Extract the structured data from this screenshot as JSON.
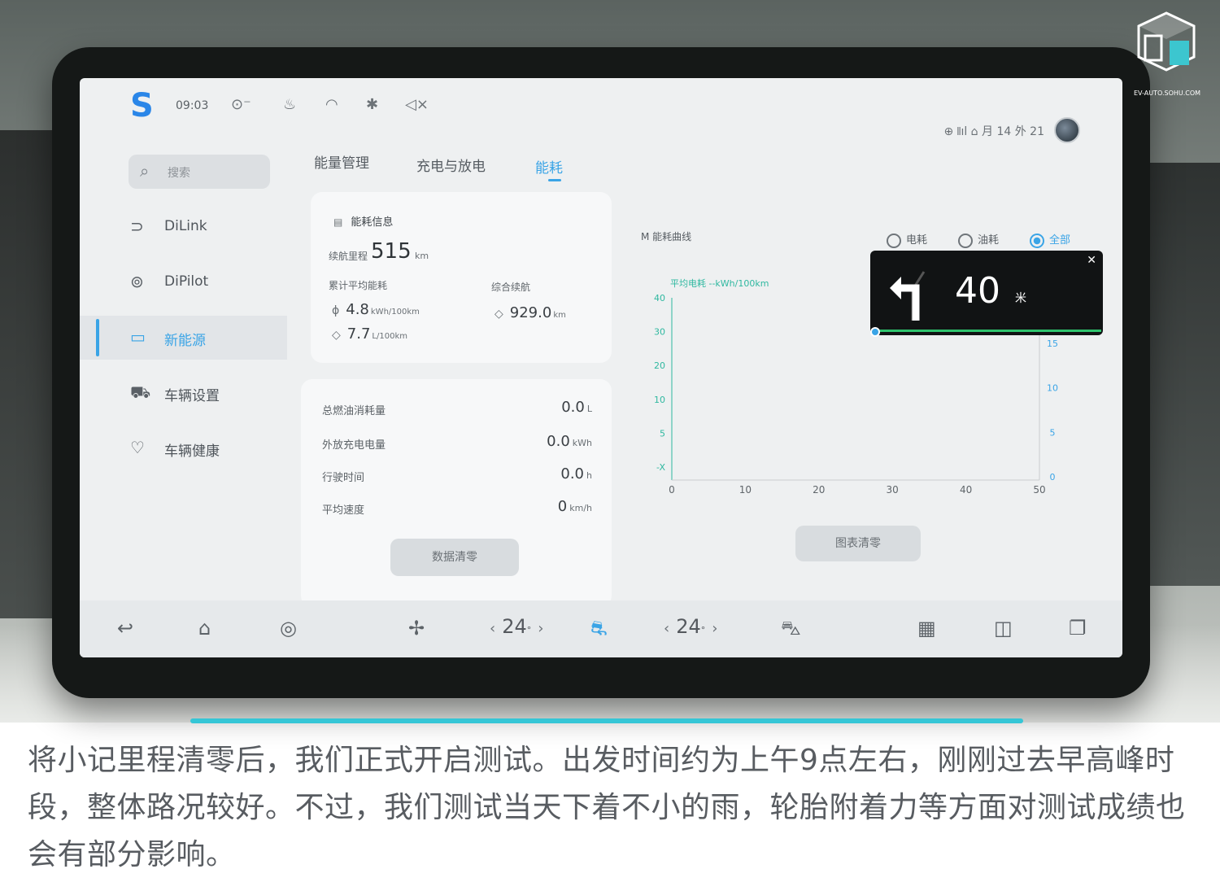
{
  "status_bar": {
    "time": "09:03",
    "icons": [
      "tire-icon",
      "seat-heat-icon",
      "wifi-icon",
      "bluetooth-icon",
      "mute-icon"
    ],
    "right_text": "⊕ 𝍪ıl  ⌂ 月 14 外 21"
  },
  "sidebar": {
    "search_placeholder": "搜索",
    "items": [
      {
        "icon": "dilink-icon",
        "label": "DiLink",
        "active": false
      },
      {
        "icon": "dipilot-icon",
        "label": "DiPilot",
        "active": false
      },
      {
        "icon": "battery-icon",
        "label": "新能源",
        "active": true
      },
      {
        "icon": "car-icon",
        "label": "车辆设置",
        "active": false
      },
      {
        "icon": "heart-icon",
        "label": "车辆健康",
        "active": false
      }
    ]
  },
  "tabs": [
    {
      "label": "能量管理",
      "active": false
    },
    {
      "label": "充电与放电",
      "active": false
    },
    {
      "label": "能耗",
      "active": true
    }
  ],
  "energy_card": {
    "title": "能耗信息",
    "range_label": "续航里程",
    "range_value": "515",
    "range_unit": "km",
    "avg_label": "累计平均能耗",
    "remaining_label": "综合续航",
    "electric_value": "4.8",
    "electric_unit": "kWh/100km",
    "fuel_value": "7.7",
    "fuel_unit": "L/100km",
    "remaining_value": "929.0",
    "remaining_unit": "km"
  },
  "stats_card": {
    "rows": [
      {
        "label": "总燃油消耗量",
        "value": "0.0",
        "unit": "L"
      },
      {
        "label": "外放充电电量",
        "value": "0.0",
        "unit": "kWh"
      },
      {
        "label": "行驶时间",
        "value": "0.0",
        "unit": "h"
      },
      {
        "label": "平均速度",
        "value": "0",
        "unit": "km/h"
      }
    ],
    "reset_button": "数据清零"
  },
  "chart_section": {
    "title": "能耗曲线",
    "filters": [
      {
        "label": "电耗",
        "selected": false
      },
      {
        "label": "油耗",
        "selected": false
      },
      {
        "label": "全部",
        "selected": true
      }
    ],
    "legend": "平均电耗 --kWh/100km",
    "reset_button": "图表清零"
  },
  "chart_data": {
    "type": "line",
    "series": [],
    "x_ticks": [
      "0",
      "10",
      "20",
      "30",
      "40",
      "50"
    ],
    "y_left_ticks": [
      "40",
      "30",
      "20",
      "10",
      "5",
      "-X"
    ],
    "y_right_ticks": [
      "15",
      "10",
      "5",
      "0"
    ],
    "xlim": [
      0,
      50
    ],
    "grid": false
  },
  "nav_popup": {
    "distance": "40",
    "unit": "米",
    "direction": "turn-left-icon",
    "close": "✕"
  },
  "dock": {
    "left_temp": "24",
    "right_temp": "24",
    "icons_left": [
      "back-icon",
      "home-icon",
      "settings-dial-icon",
      "fan-icon"
    ],
    "icons_right": [
      "defrost-icon",
      "apps-icon",
      "split-icon",
      "multitask-icon"
    ]
  },
  "watermark": {
    "site": "EV-AUTO.SOHU.COM"
  },
  "caption": "将小记里程清零后，我们正式开启测试。出发时间约为上午9点左右，刚刚过去早高峰时段，整体路况较好。不过，我们测试当天下着不小的雨，轮胎附着力等方面对测试成绩也会有部分影响。",
  "colors": {
    "accent": "#3aa4e6",
    "caption_line": "#35c6d6",
    "legend_green": "#2fb8a0"
  }
}
